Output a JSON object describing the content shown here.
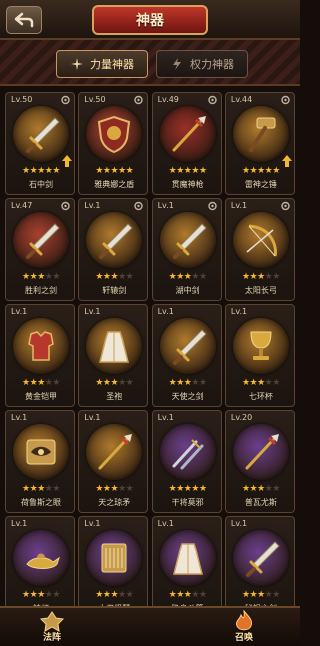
{
  "header": {
    "title": "神器",
    "back_label": "back"
  },
  "tabs": [
    {
      "label": "力量神器",
      "active": true,
      "icon": "sword-cross-icon"
    },
    {
      "label": "权力神器",
      "active": false,
      "icon": "lightning-icon"
    }
  ],
  "artifacts": [
    {
      "level": "Lv.50",
      "name": "石中剑",
      "stars": 5,
      "orb": "#b07a2c",
      "item": "sword",
      "upgrade": true
    },
    {
      "level": "Lv.50",
      "name": "雅典娜之盾",
      "stars": 5,
      "orb": "#a8402f",
      "item": "shield",
      "upgrade": false
    },
    {
      "level": "Lv.49",
      "name": "贯魔神枪",
      "stars": 5,
      "orb": "#9a2f28",
      "item": "spear",
      "upgrade": false
    },
    {
      "level": "Lv.44",
      "name": "雷神之锤",
      "stars": 5,
      "orb": "#b07a2c",
      "item": "hammer",
      "upgrade": true
    },
    {
      "level": "Lv.47",
      "name": "胜利之剑",
      "stars": 3,
      "orb": "#a8402f",
      "item": "sword",
      "upgrade": false
    },
    {
      "level": "Lv.1",
      "name": "轩辕剑",
      "stars": 3,
      "orb": "#b07a2c",
      "item": "sword",
      "upgrade": false
    },
    {
      "level": "Lv.1",
      "name": "湖中剑",
      "stars": 3,
      "orb": "#b07a2c",
      "item": "sword",
      "upgrade": false
    },
    {
      "level": "Lv.1",
      "name": "太阳长弓",
      "stars": 3,
      "orb": "#b07a2c",
      "item": "bow",
      "upgrade": false
    },
    {
      "level": "Lv.1",
      "name": "黄金铠甲",
      "stars": 3,
      "orb": "#b07a2c",
      "item": "armor",
      "upgrade": false
    },
    {
      "level": "Lv.1",
      "name": "圣袍",
      "stars": 3,
      "orb": "#b07a2c",
      "item": "robe",
      "upgrade": false
    },
    {
      "level": "Lv.1",
      "name": "天使之剑",
      "stars": 3,
      "orb": "#b07a2c",
      "item": "sword",
      "upgrade": false
    },
    {
      "level": "Lv.1",
      "name": "七环杯",
      "stars": 3,
      "orb": "#b07a2c",
      "item": "cup",
      "upgrade": false
    },
    {
      "level": "Lv.1",
      "name": "荷鲁斯之眼",
      "stars": 3,
      "orb": "#b07a2c",
      "item": "eye",
      "upgrade": false
    },
    {
      "level": "Lv.1",
      "name": "天之琼矛",
      "stars": 3,
      "orb": "#b07a2c",
      "item": "spear",
      "upgrade": false
    },
    {
      "level": "Lv.1",
      "name": "干将莫邪",
      "stars": 5,
      "orb": "#6a3f8c",
      "item": "dagger",
      "upgrade": false
    },
    {
      "level": "Lv.20",
      "name": "普瓦尤斯",
      "stars": 3,
      "orb": "#6a3f8c",
      "item": "spear",
      "upgrade": false
    },
    {
      "level": "Lv.1",
      "name": "神灯",
      "stars": 3,
      "orb": "#6a3f8c",
      "item": "lamp",
      "upgrade": false
    },
    {
      "level": "Lv.1",
      "name": "大卫竖琴",
      "stars": 3,
      "orb": "#6a3f8c",
      "item": "harp",
      "upgrade": false
    },
    {
      "level": "Lv.1",
      "name": "隐身斗篷",
      "stars": 3,
      "orb": "#6a3f8c",
      "item": "robe",
      "upgrade": false
    },
    {
      "level": "Lv.1",
      "name": "秘银之剑",
      "stars": 3,
      "orb": "#6a3f8c",
      "item": "sword",
      "upgrade": false
    }
  ],
  "bottom_nav": [
    {
      "label": "法阵",
      "icon": "rune-circle-icon"
    },
    {
      "label": "召唤",
      "icon": "summon-flame-icon"
    }
  ],
  "colors": {
    "star_on": "#f5b733",
    "star_off": "#4f4135",
    "title_red": "#c0362a"
  }
}
